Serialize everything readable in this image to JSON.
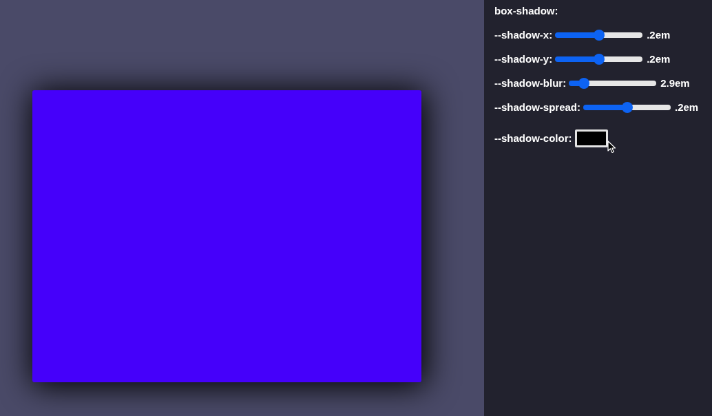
{
  "controls": {
    "title": "box-shadow:",
    "rows": [
      {
        "kind": "slider",
        "label": "--shadow-x:",
        "level": 0.5,
        "reading": ".2em"
      },
      {
        "kind": "slider",
        "label": "--shadow-y:",
        "level": 0.5,
        "reading": ".2em"
      },
      {
        "kind": "slider",
        "label": "--shadow-blur:",
        "level": 0.17,
        "reading": "2.9em"
      },
      {
        "kind": "slider",
        "label": "--shadow-spread:",
        "level": 0.5,
        "reading": ".2em"
      },
      {
        "kind": "color",
        "label": "--shadow-color:",
        "color": "#000000"
      }
    ]
  }
}
